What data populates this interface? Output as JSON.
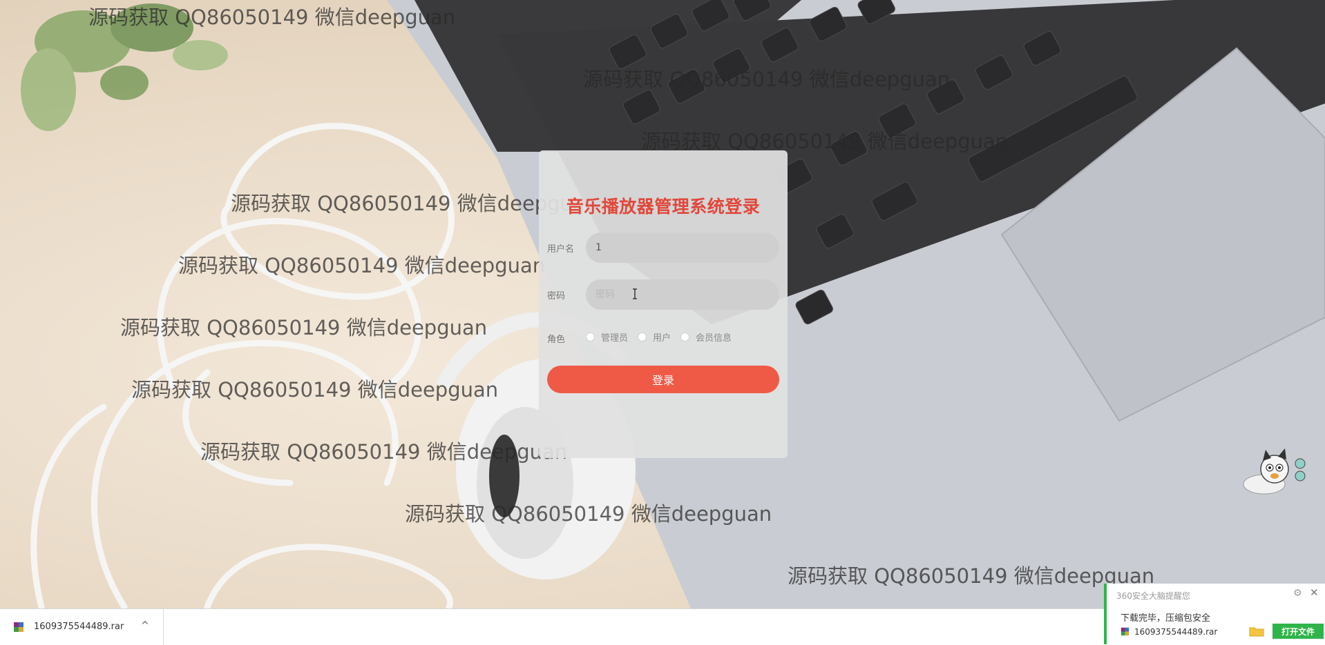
{
  "watermark_text": "源码获取 QQ86050149 微信deepguan",
  "login": {
    "title": "音乐播放器管理系统登录",
    "username_label": "用户名",
    "username_value": "1",
    "password_label": "密码",
    "password_placeholder": "密码",
    "role_label": "角色",
    "roles": [
      "管理员",
      "用户",
      "会员信息"
    ],
    "submit_label": "登录"
  },
  "download_bar": {
    "filename": "1609375544489.rar",
    "chevron": "^"
  },
  "popup": {
    "header": "360安全大脑提醒您",
    "message": "下载完毕，压缩包安全",
    "filename": "1609375544489.rar",
    "open_button": "打开文件"
  },
  "colors": {
    "title_red": "#e2473a",
    "button_red": "#ef5a47",
    "popup_green": "#2fb44a"
  },
  "icons": [
    "archive-rar-icon",
    "chevron-up-icon",
    "gear-icon",
    "close-icon",
    "folder-icon",
    "mascot-icon",
    "text-cursor-icon"
  ]
}
